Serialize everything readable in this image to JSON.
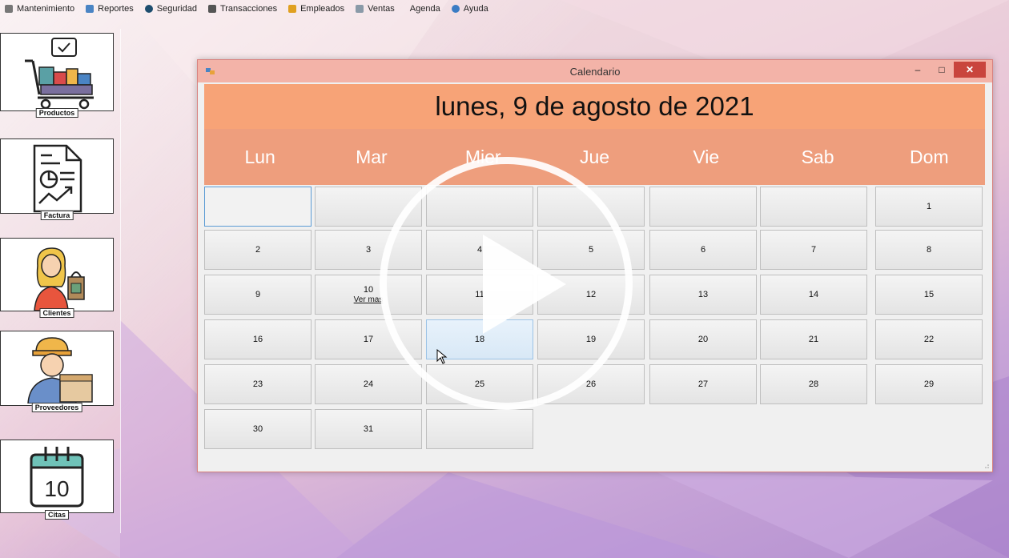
{
  "menu": [
    {
      "label": "Mantenimiento",
      "icon": "wrench-icon"
    },
    {
      "label": "Reportes",
      "icon": "chart-icon"
    },
    {
      "label": "Seguridad",
      "icon": "shield-dot-icon"
    },
    {
      "label": "Transacciones",
      "icon": "money-bag-icon"
    },
    {
      "label": "Empleados",
      "icon": "person-icon"
    },
    {
      "label": "Ventas",
      "icon": "receipt-icon"
    },
    {
      "label": "Agenda",
      "icon": "calendar-icon"
    },
    {
      "label": "Ayuda",
      "icon": "info-icon"
    }
  ],
  "sidebar": {
    "tiles": [
      {
        "label": "Productos",
        "icon": "cart-products-icon"
      },
      {
        "label": "Factura",
        "icon": "invoice-chart-icon"
      },
      {
        "label": "Clientes",
        "icon": "shopper-woman-icon"
      },
      {
        "label": "Proveedores",
        "icon": "worker-box-icon"
      },
      {
        "label": "Citas",
        "icon": "calendar-10-icon"
      }
    ],
    "calendar_icon_number": "10"
  },
  "window": {
    "title": "Calendario",
    "controls": {
      "minimize": "–",
      "maximize": "□",
      "close": "✕"
    },
    "date_heading": "lunes, 9 de agosto de 2021",
    "weekdays": [
      "Lun",
      "Mar",
      "Mier",
      "Jue",
      "Vie",
      "Sab",
      "Dom"
    ],
    "weeks": [
      [
        "",
        "",
        "",
        "",
        "",
        "",
        "1"
      ],
      [
        "2",
        "3",
        "4",
        "5",
        "6",
        "7",
        "8"
      ],
      [
        "9",
        "10",
        "11",
        "12",
        "13",
        "14",
        "15"
      ],
      [
        "16",
        "17",
        "18",
        "19",
        "20",
        "21",
        "22"
      ],
      [
        "23",
        "24",
        "25",
        "26",
        "27",
        "28",
        "29"
      ],
      [
        "30",
        "31",
        "",
        null,
        null,
        null,
        null
      ]
    ],
    "ver_mas_label": "Ver mas",
    "ver_mas_day": "10",
    "selected_day_index": [
      0,
      0
    ],
    "hover_day": "18"
  },
  "colors": {
    "header_orange": "#f7a377",
    "weekday_bar": "#ee9e7d",
    "titlebar": "#f3b3a8",
    "close_button": "#c9453d"
  }
}
